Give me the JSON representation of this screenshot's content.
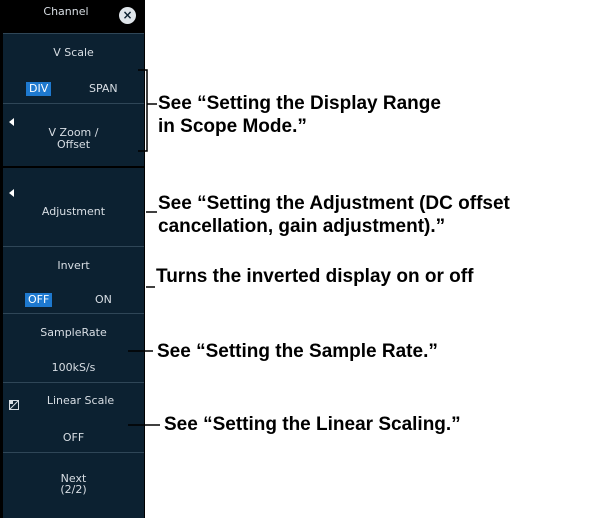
{
  "panel": {
    "title": "Channel",
    "close_glyph": "×",
    "close_icon": "close-icon",
    "v_scale": {
      "label": "V Scale",
      "options": [
        "DIV",
        "SPAN"
      ],
      "selected": "DIV"
    },
    "v_zoom_offset": {
      "line1": "V Zoom /",
      "line2": "Offset"
    },
    "adjustment": {
      "label": "Adjustment"
    },
    "invert": {
      "label": "Invert",
      "options": [
        "OFF",
        "ON"
      ],
      "selected": "OFF"
    },
    "sample_rate": {
      "label": "SampleRate",
      "value": "100kS/s"
    },
    "linear_scale": {
      "label": "Linear Scale",
      "value": "OFF"
    },
    "next": {
      "line1": "Next",
      "line2": "(2/2)"
    }
  },
  "annotations": {
    "display_range_1": "See “Setting the Display Range",
    "display_range_2": "in Scope Mode.”",
    "adjustment_1": "See “Setting the Adjustment (DC offset",
    "adjustment_2": "cancellation, gain adjustment).”",
    "invert": "Turns the inverted display on or off",
    "sample_rate": "See “Setting the Sample Rate.”",
    "linear_scaling": "See “Setting the Linear Scaling.”"
  },
  "colors": {
    "panel_bg": "#0c2131",
    "panel_border": "#000000",
    "selected_bg": "#1e79cf",
    "text": "#d8dee4"
  }
}
